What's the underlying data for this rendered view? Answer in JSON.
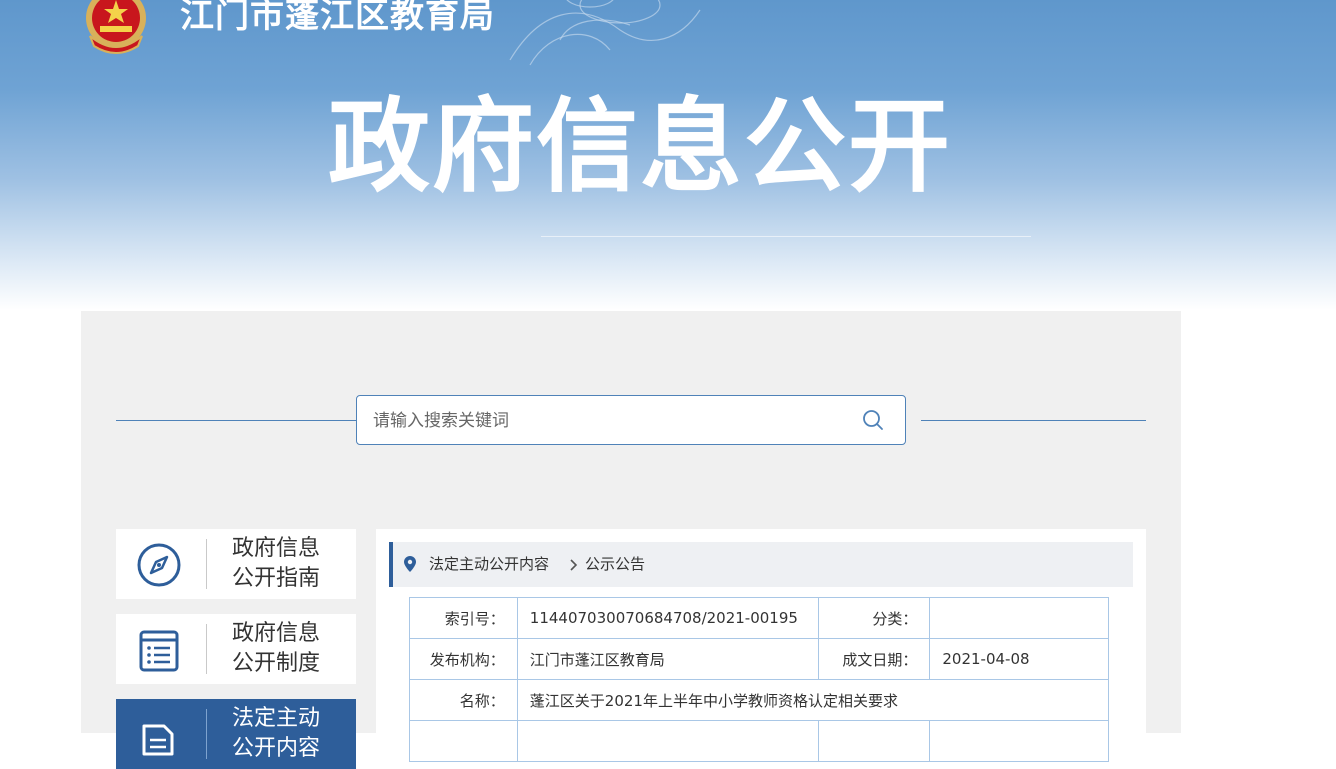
{
  "header": {
    "site_title": "江门市蓬江区教育局",
    "hero_title": "政府信息公开"
  },
  "search": {
    "placeholder": "请输入搜索关键词"
  },
  "sidebar": {
    "items": [
      {
        "label_line1": "政府信息",
        "label_line2": "公开指南",
        "icon": "compass-icon",
        "active": false
      },
      {
        "label_line1": "政府信息",
        "label_line2": "公开制度",
        "icon": "list-document-icon",
        "active": false
      },
      {
        "label_line1": "法定主动",
        "label_line2": "公开内容",
        "icon": "folder-document-icon",
        "active": true
      }
    ]
  },
  "breadcrumb": {
    "items": [
      "法定主动公开内容",
      "公示公告"
    ]
  },
  "info": {
    "index_label": "索引号：",
    "index_value": "114407030070684708/2021-00195",
    "category_label": "分类：",
    "category_value": "",
    "publisher_label": "发布机构：",
    "publisher_value": "江门市蓬江区教育局",
    "date_label": "成文日期：",
    "date_value": "2021-04-08",
    "name_label": "名称：",
    "name_value": "蓬江区关于2021年上半年中小学教师资格认定相关要求"
  },
  "colors": {
    "banner_blue": "#5f97cc",
    "accent_blue": "#2e5e9a",
    "border_blue": "#a9c7e6",
    "panel_gray": "#f0f0f0"
  }
}
